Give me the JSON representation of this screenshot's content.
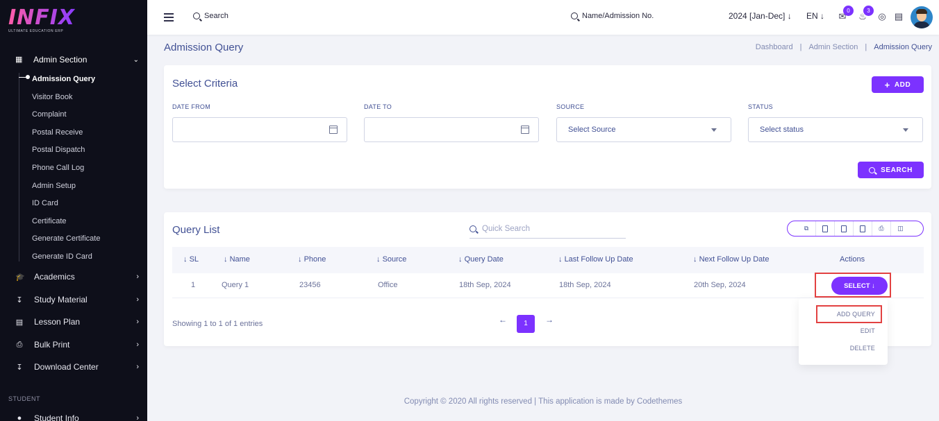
{
  "logo": {
    "name": "INFIX",
    "sub": "ULTIMATE EDUCATION ERP"
  },
  "sidebar": {
    "section": "Admin Section",
    "admin_items": [
      "Admission Query",
      "Visitor Book",
      "Complaint",
      "Postal Receive",
      "Postal Dispatch",
      "Phone Call Log",
      "Admin Setup",
      "ID Card",
      "Certificate",
      "Generate Certificate",
      "Generate ID Card"
    ],
    "menus": [
      "Academics",
      "Study Material",
      "Lesson Plan",
      "Bulk Print",
      "Download Center"
    ],
    "group_label": "STUDENT",
    "student_menu": "Student Info"
  },
  "topbar": {
    "search": "Search",
    "name_search": "Name/Admission No.",
    "session": "2024 [Jan-Dec]",
    "lang": "EN",
    "messages_count": "0",
    "notifications_count": "3"
  },
  "page": {
    "title": "Admission Query",
    "breadcrumb": [
      "Dashboard",
      "Admin Section",
      "Admission Query"
    ]
  },
  "criteria": {
    "title": "Select Criteria",
    "add_label": "ADD",
    "fields": [
      {
        "label": "DATE FROM",
        "value": ""
      },
      {
        "label": "DATE TO",
        "value": ""
      },
      {
        "label": "SOURCE",
        "value": "Select Source"
      },
      {
        "label": "STATUS",
        "value": "Select status"
      }
    ],
    "search_label": "SEARCH"
  },
  "list": {
    "title": "Query List",
    "quick_search": "Quick Search",
    "columns": [
      "SL",
      "Name",
      "Phone",
      "Source",
      "Query Date",
      "Last Follow Up Date",
      "Next Follow Up Date",
      "Actions"
    ],
    "rows": [
      {
        "sl": "1",
        "name": "Query 1",
        "phone": "23456",
        "source": "Office",
        "query_date": "18th Sep, 2024",
        "last_follow": "18th Sep, 2024",
        "next_follow": "20th Sep, 2024"
      }
    ],
    "showing": "Showing 1 to 1 of 1 entries",
    "page": "1",
    "select_label": "SELECT",
    "actions": [
      "ADD QUERY",
      "EDIT",
      "DELETE"
    ]
  },
  "footer": "Copyright © 2020 All rights reserved | This application is made by Codethemes",
  "colors": {
    "accent": "#7c32ff",
    "sidebar": "#0e0f1a",
    "text": "#415094",
    "highlight": "#e24141"
  }
}
